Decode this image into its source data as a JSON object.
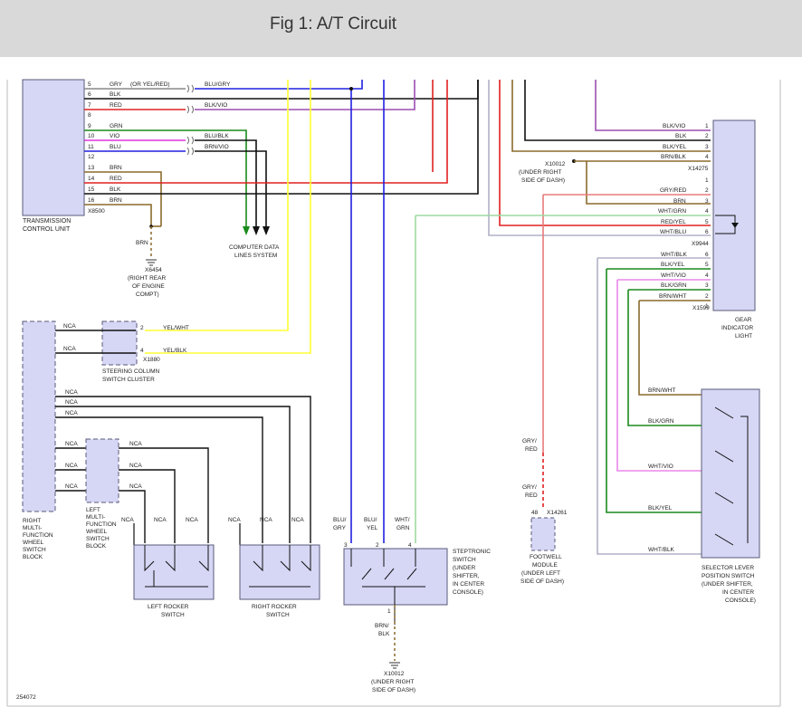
{
  "header": {
    "title": "Fig 1: A/T Circuit"
  },
  "figure_id": "254072",
  "colors": {
    "box_fill": "#d6d7f5",
    "box_stroke": "#5a5a7a",
    "blue": "#2020e0",
    "red": "#e02020",
    "violet": "#9b4fb0",
    "green": "#1a8a1a",
    "black": "#111111",
    "yellow": "#ffff33",
    "brown": "#8b6a2b",
    "white": "#b0b0c8",
    "gray": "#888888",
    "pink": "#e887e8",
    "lightgreen": "#9fd89f"
  },
  "tcu": {
    "label1": "TRANSMISSION",
    "label2": "CONTROL UNIT",
    "connector": "X8500",
    "pins": [
      {
        "num": "5",
        "color": "GRY",
        "note": "(OR YEL/RED)",
        "wire": "BLU/GRY"
      },
      {
        "num": "6",
        "color": "BLK"
      },
      {
        "num": "7",
        "color": "RED",
        "wire": "BLK/VIO"
      },
      {
        "num": "8",
        "color": ""
      },
      {
        "num": "9",
        "color": "GRN"
      },
      {
        "num": "10",
        "color": "VIO",
        "wire": "BLU/BLK"
      },
      {
        "num": "11",
        "color": "BLU",
        "wire": "BRN/VIO"
      },
      {
        "num": "12",
        "color": ""
      },
      {
        "num": "13",
        "color": "BRN"
      },
      {
        "num": "14",
        "color": "RED"
      },
      {
        "num": "15",
        "color": "BLK"
      },
      {
        "num": "16",
        "color": "BRN"
      }
    ]
  },
  "ground_x6454": {
    "wire": "BRN",
    "id": "X6454",
    "l1": "(RIGHT REAR",
    "l2": "OF ENGINE",
    "l3": "COMPT)"
  },
  "computer_data": {
    "l1": "COMPUTER DATA",
    "l2": "LINES SYSTEM"
  },
  "gear_indicator": {
    "top_pins": [
      {
        "num": "1",
        "wire": "BLK/VIO"
      },
      {
        "num": "2",
        "wire": "BLK"
      },
      {
        "num": "3",
        "wire": "BLK/YEL"
      },
      {
        "num": "4",
        "wire": "BRN/BLK"
      }
    ],
    "top_conn": "X14275",
    "mid_pins": [
      {
        "num": "1",
        "wire": ""
      },
      {
        "num": "2",
        "wire": "GRY/RED"
      },
      {
        "num": "3",
        "wire": "BRN"
      },
      {
        "num": "4",
        "wire": "WHT/GRN"
      },
      {
        "num": "5",
        "wire": "RED/YEL"
      },
      {
        "num": "6",
        "wire": "WHT/BLU"
      }
    ],
    "mid_conn": "X9944",
    "bot_pins": [
      {
        "num": "6",
        "wire": "WHT/BLK"
      },
      {
        "num": "5",
        "wire": "BLK/YEL"
      },
      {
        "num": "4",
        "wire": "WHT/VIO"
      },
      {
        "num": "3",
        "wire": "BLK/GRN"
      },
      {
        "num": "2",
        "wire": "BRN/WHT"
      },
      {
        "num": "1",
        "wire": ""
      }
    ],
    "bot_conn": "X1599",
    "l1": "GEAR",
    "l2": "INDICATOR",
    "l3": "LIGHT"
  },
  "ground_x10012_top": {
    "id": "X10012",
    "l1": "(UNDER RIGHT",
    "l2": "SIDE OF DASH)"
  },
  "steering_cluster": {
    "pin2": "2",
    "wire2": "YEL/WHT",
    "pin4": "4",
    "wire4": "YEL/BLK",
    "conn": "X1880",
    "l1": "STEERING COLUMN",
    "l2": "SWITCH CLUSTER"
  },
  "right_mfw": {
    "lines": [
      "RIGHT",
      "MULTI-",
      "FUNCTION",
      "WHEEL",
      "SWITCH",
      "BLOCK"
    ]
  },
  "left_mfw": {
    "lines": [
      "LEFT",
      "MULTI-",
      "FUNCTION",
      "WHEEL",
      "SWITCH",
      "BLOCK"
    ]
  },
  "nca": "NCA",
  "left_rocker": {
    "l1": "LEFT ROCKER",
    "l2": "SWITCH"
  },
  "right_rocker": {
    "l1": "RIGHT ROCKER",
    "l2": "SWITCH"
  },
  "steptronic": {
    "wires": [
      {
        "pin": "3",
        "c1": "BLU/",
        "c2": "GRY"
      },
      {
        "pin": "2",
        "c1": "BLU/",
        "c2": "YEL"
      },
      {
        "pin": "4",
        "c1": "WHT/",
        "c2": "GRN"
      }
    ],
    "lines": [
      "STEPTRONIC",
      "SWITCH",
      "(UNDER",
      "SHIFTER,",
      "IN CENTER",
      "CONSOLE)"
    ],
    "bottom_pin": "1",
    "bottom_wire1": "BRN/",
    "bottom_wire2": "BLK"
  },
  "ground_x10012_bottom": {
    "id": "X10012",
    "l1": "(UNDER RIGHT",
    "l2": "SIDE OF DASH)"
  },
  "footwell": {
    "wire_top1": "GRY/",
    "wire_top2": "RED",
    "wire_bot1": "GRY/",
    "wire_bot2": "RED",
    "pin": "48",
    "conn": "X14261",
    "lines": [
      "FOOTWELL",
      "MODULE",
      "(UNDER LEFT",
      "SIDE OF DASH)"
    ]
  },
  "selector": {
    "wires": [
      "BRN/WHT",
      "BLK/GRN",
      "WHT/VIO",
      "BLK/YEL",
      "WHT/BLK"
    ],
    "lines": [
      "SELECTOR LEVER",
      "POSITION SWITCH",
      "(UNDER SHIFTER,",
      "IN CENTER",
      "CONSOLE)"
    ]
  }
}
